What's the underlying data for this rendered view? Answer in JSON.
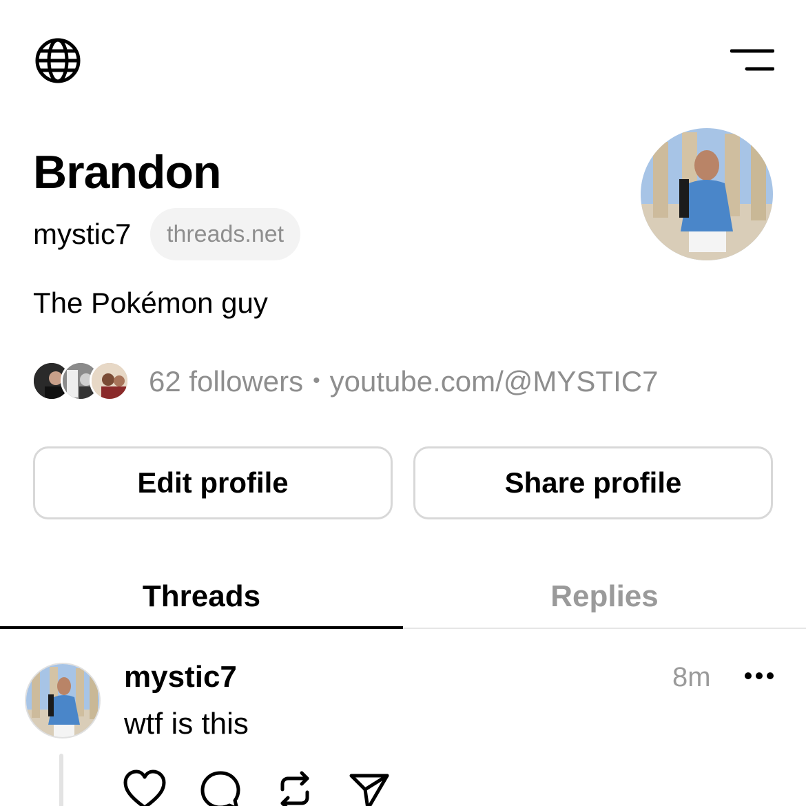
{
  "header": {
    "left_icon": "globe-icon",
    "right_icon": "menu-icon"
  },
  "profile": {
    "display_name": "Brandon",
    "username": "mystic7",
    "domain_chip": "threads.net",
    "bio": "The Pokémon guy",
    "followers": "62 followers",
    "separator": "•",
    "link": "youtube.com/@MYSTIC7"
  },
  "buttons": {
    "edit": "Edit profile",
    "share": "Share profile"
  },
  "tabs": [
    {
      "label": "Threads",
      "active": true
    },
    {
      "label": "Replies",
      "active": false
    }
  ],
  "post": {
    "username": "mystic7",
    "time": "8m",
    "text": "wtf is this",
    "actions": [
      "heart-icon",
      "comment-icon",
      "repost-icon",
      "send-icon"
    ]
  },
  "colors": {
    "text": "#000000",
    "muted": "#8e8e8e",
    "chip_bg": "#f3f3f3",
    "border": "#d8d8d8"
  }
}
